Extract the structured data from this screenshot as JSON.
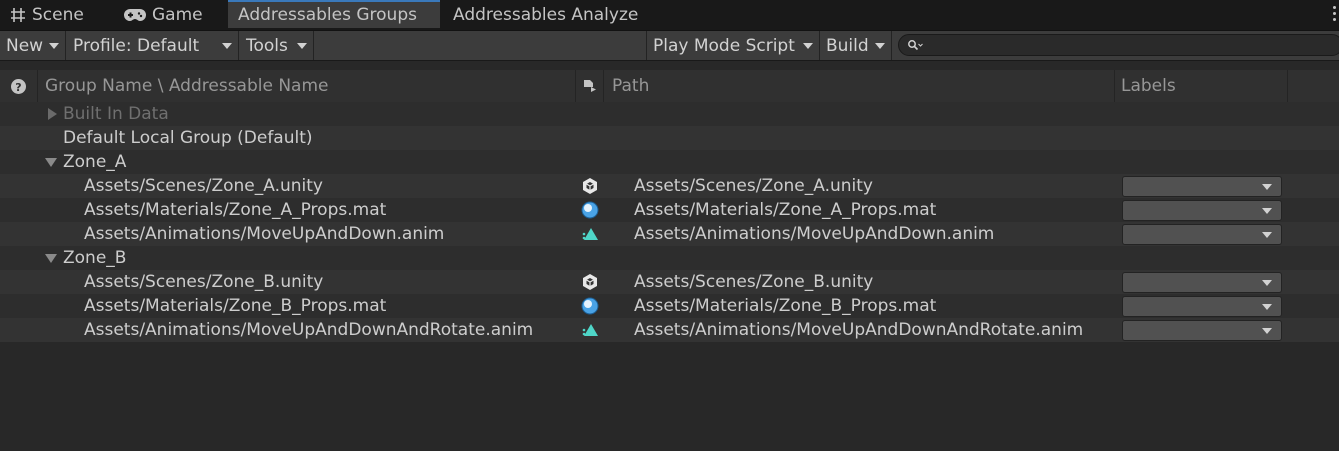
{
  "tabs": [
    {
      "label": "Scene",
      "icon": "grid-icon"
    },
    {
      "label": "Game",
      "icon": "gamepad-icon"
    },
    {
      "label": "Addressables Groups",
      "icon": ""
    },
    {
      "label": "Addressables Analyze",
      "icon": ""
    }
  ],
  "toolbar": {
    "new_label": "New",
    "profile_label": "Profile: Default",
    "tools_label": "Tools",
    "play_mode_label": "Play Mode Script",
    "build_label": "Build",
    "search_value": ""
  },
  "columns": {
    "name": "Group Name \\ Addressable Name",
    "path": "Path",
    "labels": "Labels"
  },
  "groups": [
    {
      "name": "Built In Data",
      "state": "collapsed",
      "dim": true,
      "entries": []
    },
    {
      "name": "Default Local Group (Default)",
      "state": "none",
      "dim": false,
      "entries": []
    },
    {
      "name": "Zone_A",
      "state": "expanded",
      "dim": false,
      "entries": [
        {
          "name": "Assets/Scenes/Zone_A.unity",
          "type": "scene-icon",
          "path": "Assets/Scenes/Zone_A.unity"
        },
        {
          "name": "Assets/Materials/Zone_A_Props.mat",
          "type": "material-icon",
          "path": "Assets/Materials/Zone_A_Props.mat"
        },
        {
          "name": "Assets/Animations/MoveUpAndDown.anim",
          "type": "animation-icon",
          "path": "Assets/Animations/MoveUpAndDown.anim"
        }
      ]
    },
    {
      "name": "Zone_B",
      "state": "expanded",
      "dim": false,
      "entries": [
        {
          "name": "Assets/Scenes/Zone_B.unity",
          "type": "scene-icon",
          "path": "Assets/Scenes/Zone_B.unity"
        },
        {
          "name": "Assets/Materials/Zone_B_Props.mat",
          "type": "material-icon",
          "path": "Assets/Materials/Zone_B_Props.mat"
        },
        {
          "name": "Assets/Animations/MoveUpAndDownAndRotate.anim",
          "type": "animation-icon",
          "path": "Assets/Animations/MoveUpAndDownAndRotate.anim"
        }
      ]
    }
  ],
  "colors": {
    "active_tab_accent": "#3a79bb",
    "material_icon": "#4aa3e6",
    "animation_icon": "#4fd6c8"
  }
}
